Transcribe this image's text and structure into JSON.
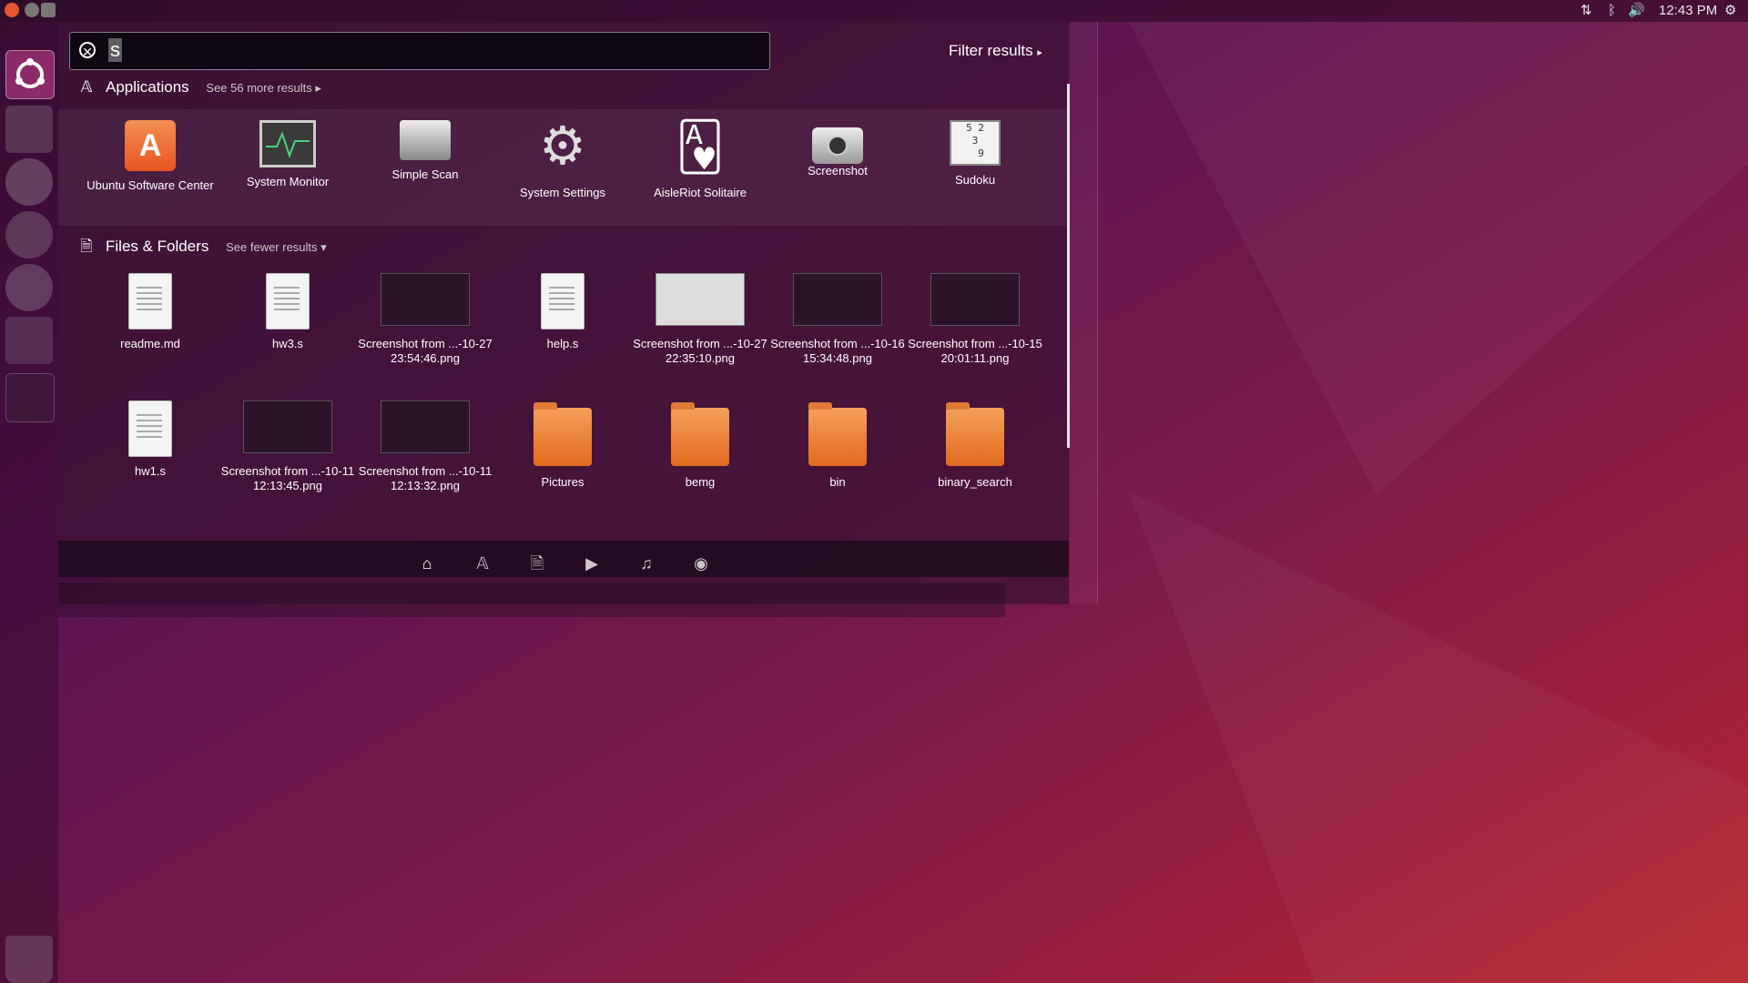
{
  "top_panel": {
    "window_controls": [
      "close",
      "minimize",
      "maximize"
    ],
    "tray_icons": [
      "network-icon",
      "bluetooth-icon",
      "volume-icon",
      "gear-icon"
    ],
    "clock": "12:43 PM"
  },
  "launcher": {
    "items": [
      "ubuntu-dash",
      "files",
      "browser",
      "settings",
      "disk",
      "input-method",
      "terminal",
      "trash"
    ]
  },
  "search": {
    "value": "s",
    "filter_label": "Filter results"
  },
  "applications": {
    "header": "Applications",
    "see_more": "See 56 more results",
    "items": [
      {
        "label": "Ubuntu Software Center",
        "icon": "software-center-icon"
      },
      {
        "label": "System Monitor",
        "icon": "system-monitor-icon"
      },
      {
        "label": "Simple Scan",
        "icon": "scanner-icon"
      },
      {
        "label": "System Settings",
        "icon": "settings-icon"
      },
      {
        "label": "AisleRiot Solitaire",
        "icon": "cards-icon"
      },
      {
        "label": "Screenshot",
        "icon": "camera-icon"
      },
      {
        "label": "Sudoku",
        "icon": "sudoku-icon"
      }
    ]
  },
  "files": {
    "header": "Files & Folders",
    "see_fewer": "See fewer results",
    "items": [
      {
        "label": "readme.md",
        "kind": "doc"
      },
      {
        "label": "hw3.s",
        "kind": "doc"
      },
      {
        "label": "Screenshot from ...-10-27 23:54:46.png",
        "kind": "thumb"
      },
      {
        "label": "help.s",
        "kind": "doc"
      },
      {
        "label": "Screenshot from ...-10-27 22:35:10.png",
        "kind": "thumb-light"
      },
      {
        "label": "Screenshot from ...-10-16 15:34:48.png",
        "kind": "thumb"
      },
      {
        "label": "Screenshot from ...-10-15 20:01:11.png",
        "kind": "thumb"
      },
      {
        "label": "hw1.s",
        "kind": "doc"
      },
      {
        "label": "Screenshot from ...-10-11 12:13:45.png",
        "kind": "thumb"
      },
      {
        "label": "Screenshot from ...-10-11 12:13:32.png",
        "kind": "thumb"
      },
      {
        "label": "Pictures",
        "kind": "folder"
      },
      {
        "label": "bemg",
        "kind": "folder"
      },
      {
        "label": "bin",
        "kind": "folder"
      },
      {
        "label": "binary_search",
        "kind": "folder"
      }
    ]
  },
  "lenses": [
    "home-icon",
    "applications-icon",
    "files-icon",
    "video-icon",
    "music-icon",
    "photo-icon"
  ],
  "colors": {
    "accent": "#e95420",
    "launcher_bfb": "#8c2b69"
  }
}
